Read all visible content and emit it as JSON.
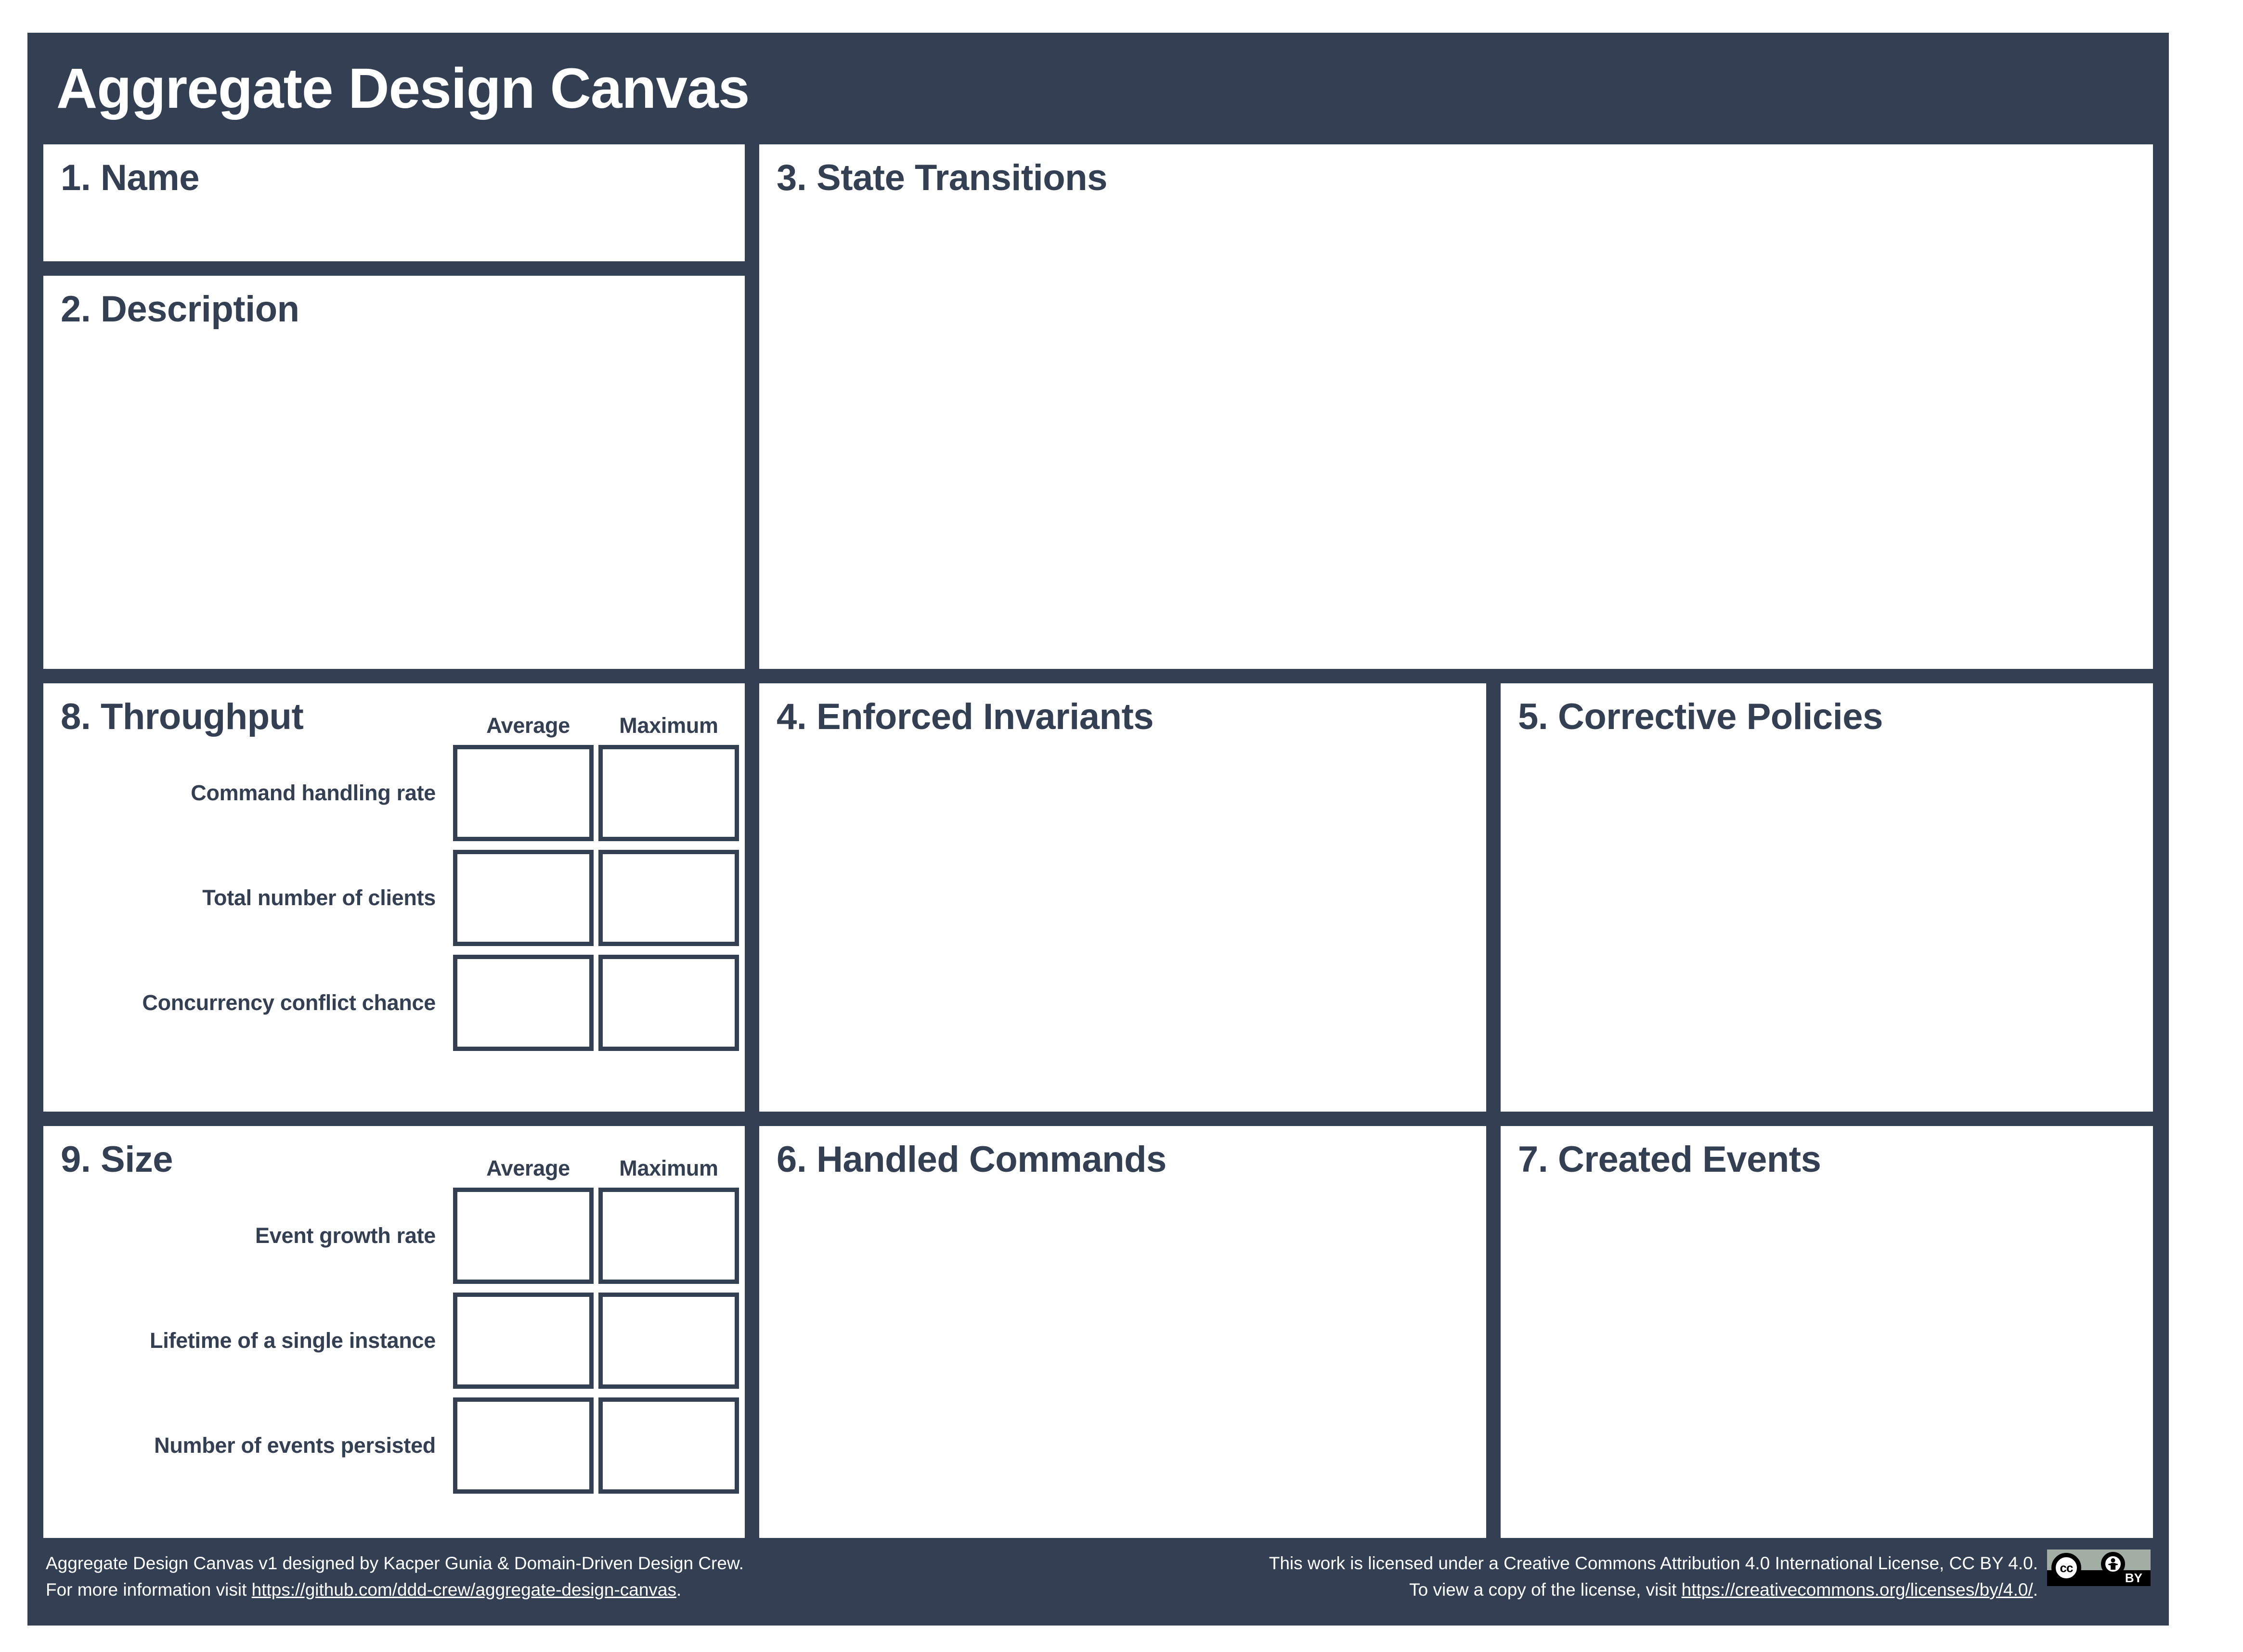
{
  "title": "Aggregate Design Canvas",
  "colors": {
    "navy": "#333f52",
    "panel_bg": "#ffffff",
    "badge_bg": "#a2aea3",
    "badge_bar": "#000000"
  },
  "panels": {
    "name": "1. Name",
    "description": "2. Description",
    "state_transitions": "3. State Transitions",
    "throughput": "8. Throughput",
    "enforced_invariants": "4. Enforced Invariants",
    "corrective_policies": "5. Corrective Policies",
    "size": "9. Size",
    "handled_commands": "6. Handled Commands",
    "created_events": "7. Created Events"
  },
  "throughput": {
    "columns": [
      "Average",
      "Maximum"
    ],
    "rows": [
      "Command handling rate",
      "Total number of clients",
      "Concurrency conflict chance"
    ],
    "values": [
      [
        "",
        ""
      ],
      [
        "",
        ""
      ],
      [
        "",
        ""
      ]
    ]
  },
  "size": {
    "columns": [
      "Average",
      "Maximum"
    ],
    "rows": [
      "Event growth rate",
      "Lifetime of a single instance",
      "Number of events persisted"
    ],
    "values": [
      [
        "",
        ""
      ],
      [
        "",
        ""
      ],
      [
        "",
        ""
      ]
    ]
  },
  "footer": {
    "left_line1": "Aggregate Design Canvas v1 designed by Kacper Gunia & Domain-Driven Design Crew.",
    "left_line2_prefix": "For more information visit ",
    "left_line2_link": "https://github.com/ddd-crew/aggregate-design-canvas",
    "left_line2_suffix": ".",
    "right_line1": "This work is licensed under a Creative Commons Attribution 4.0 International License, CC BY 4.0.",
    "right_line2_prefix": "To view a copy of the license, visit ",
    "right_line2_link": "https://creativecommons.org/licenses/by/4.0/",
    "right_line2_suffix": ".",
    "badge_cc": "cc",
    "badge_by": "BY"
  }
}
